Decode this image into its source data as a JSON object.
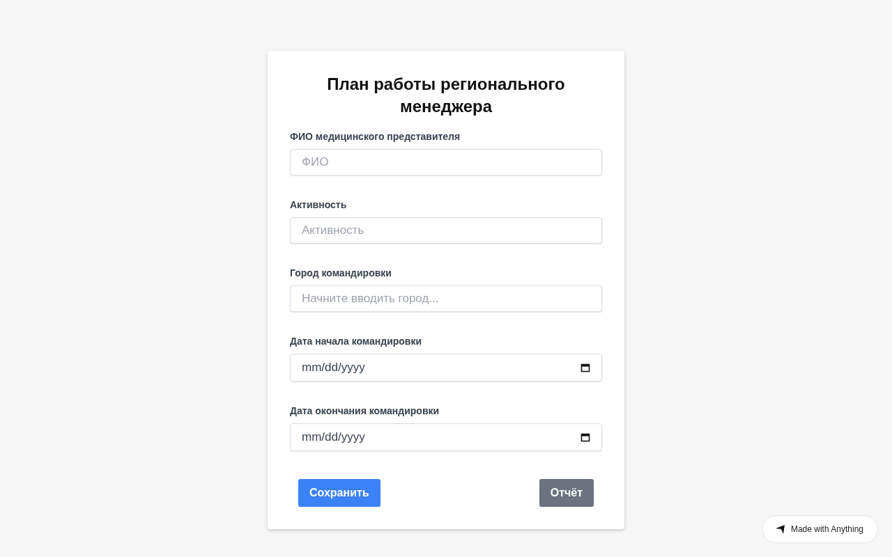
{
  "form": {
    "title": "План работы регионального менеджера",
    "fields": [
      {
        "label": "ФИО медицинского представителя",
        "kind": "text",
        "placeholder": "ФИО"
      },
      {
        "label": "Активность",
        "kind": "text",
        "placeholder": "Активность"
      },
      {
        "label": "Город командировки",
        "kind": "text",
        "placeholder": "Начните вводить город..."
      },
      {
        "label": "Дата начала командировки",
        "kind": "date",
        "placeholder": "mm/dd/yyyy"
      },
      {
        "label": "Дата окончания командировки",
        "kind": "date",
        "placeholder": "mm/dd/yyyy"
      }
    ],
    "buttons": [
      {
        "label": "Сохранить",
        "kind": "primary"
      },
      {
        "label": "Отчёт",
        "kind": "secondary"
      }
    ]
  },
  "badge": {
    "text": "Made with Anything"
  }
}
